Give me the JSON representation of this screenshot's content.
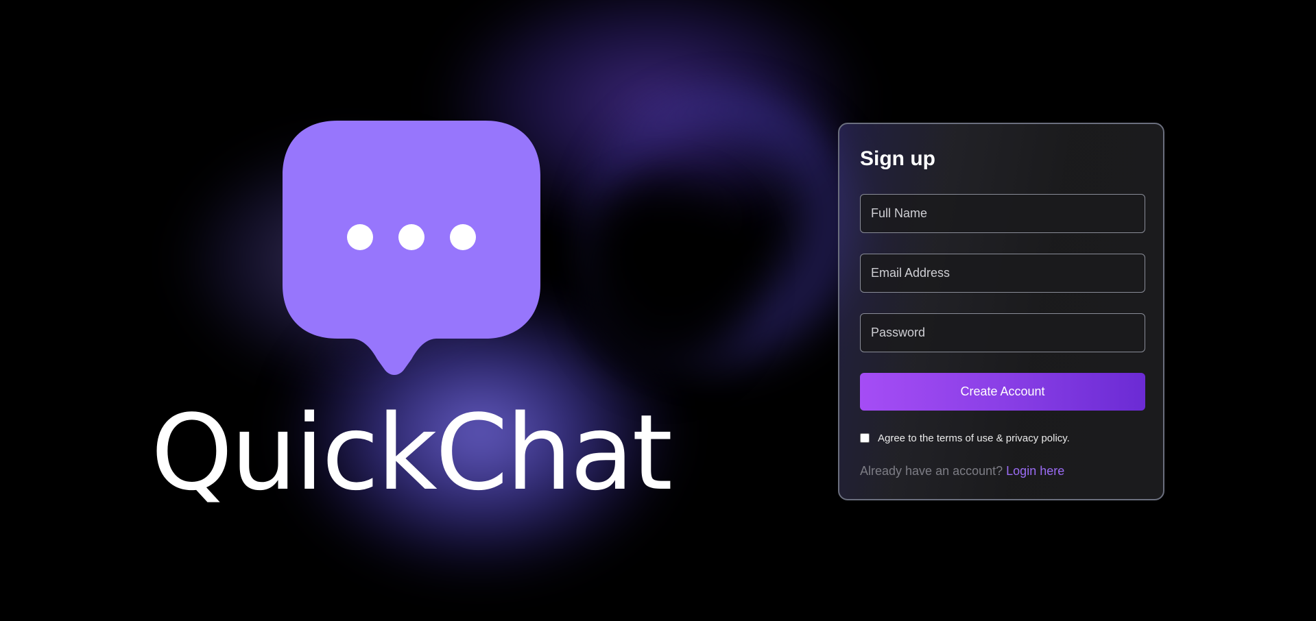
{
  "brand": {
    "name": "QuickChat",
    "logo_icon": "chat-bubble-ellipsis-icon",
    "logo_color": "#9776fc"
  },
  "signup": {
    "title": "Sign up",
    "full_name_placeholder": "Full Name",
    "email_placeholder": "Email Address",
    "password_placeholder": "Password",
    "submit_label": "Create Account",
    "terms_label": "Agree to the terms of use & privacy policy.",
    "terms_checked": false,
    "login_prompt": "Already have an account?",
    "login_link": "Login here"
  },
  "colors": {
    "background": "#000000",
    "card_border": "#6b6f7e",
    "button_gradient_start": "#a54df5",
    "button_gradient_end": "#6b2bd4",
    "link": "#9b6cf5"
  }
}
